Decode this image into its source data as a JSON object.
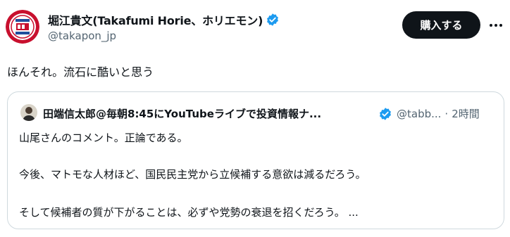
{
  "author": {
    "name": "堀江貴文(Takafumi Horie、ホリエモン)",
    "handle": "@takapon_jp",
    "avatar_icon": "round-badge-logo-icon",
    "verified_icon": "verified-badge-icon"
  },
  "actions": {
    "buy_label": "購入する",
    "more_icon": "more-icon"
  },
  "tweet": {
    "text": "ほんそれ。流石に酷いと思う"
  },
  "quote": {
    "name": "田端信太郎@毎朝8:45にYouTubeライブで投資情報ナ...",
    "handle": "@tabb...",
    "dot": "·",
    "time": "2時間",
    "lines": [
      "山尾さんのコメント。正論である。",
      "今後、マトモな人材ほど、国民民主党から立候補する意欲は減るだろう。",
      "そして候補者の質が下がることは、必ずや党勢の衰退を招くだろう。 ..."
    ]
  },
  "colors": {
    "primary_text": "#0f1419",
    "secondary_text": "#536471",
    "verified_blue": "#1d9bf0",
    "border": "#cfd9de",
    "button_bg": "#0f1419"
  }
}
